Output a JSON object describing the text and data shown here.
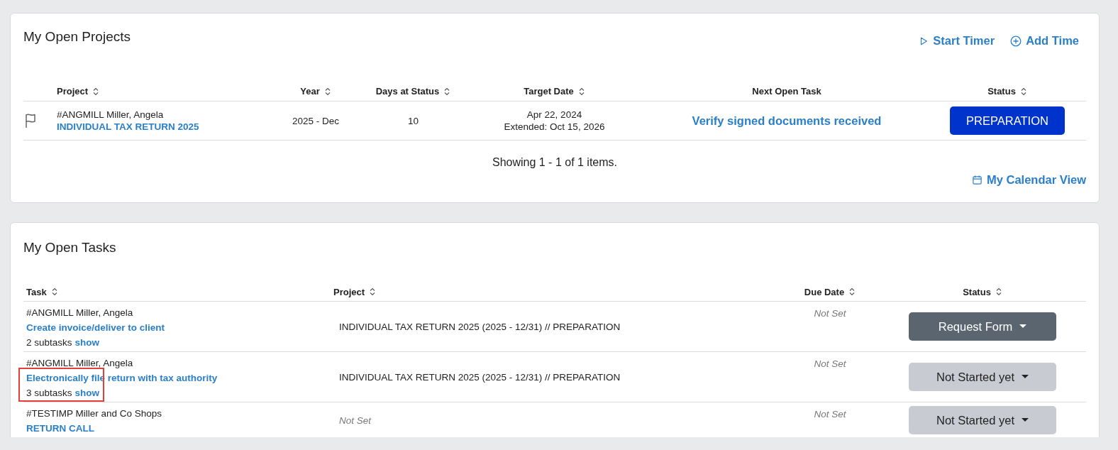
{
  "projects_card": {
    "title": "My Open Projects",
    "actions": [
      {
        "label": "Start Timer",
        "kind": "play"
      },
      {
        "label": "Add Time",
        "kind": "plus"
      }
    ],
    "columns": [
      "Project",
      "Year",
      "Days at Status",
      "Target Date",
      "Next Open Task",
      "Status"
    ],
    "rows": [
      {
        "client": "#ANGMILL Miller, Angela",
        "project": "INDIVIDUAL TAX RETURN 2025",
        "year": "2025 - Dec",
        "days": "10",
        "target": "Apr 22, 2024",
        "extended": "Extended: Oct 15, 2026",
        "next_task": "Verify signed documents received",
        "status": "PREPARATION"
      }
    ],
    "summary": "Showing 1 - 1 of 1 items.",
    "calendar_link": "My Calendar View"
  },
  "tasks_card": {
    "title": "My Open Tasks",
    "columns": [
      "Task",
      "Project",
      "Due Date",
      "Status"
    ],
    "rows": [
      {
        "client": "#ANGMILL Miller, Angela",
        "task": "Create invoice/deliver to client",
        "subtasks": "2 subtasks",
        "show": "show",
        "highlighted": false,
        "project": "INDIVIDUAL TAX RETURN 2025 (2025 - 12/31) // PREPARATION",
        "project_missing": false,
        "due": "Not Set",
        "due_missing": true,
        "status": "Request Form",
        "kind": "filled"
      },
      {
        "client": "#ANGMILL Miller, Angela",
        "task": "Electronically file return with tax authority",
        "subtasks": "3 subtasks",
        "show": "show",
        "highlighted": true,
        "project": "INDIVIDUAL TAX RETURN 2025 (2025 - 12/31) // PREPARATION",
        "project_missing": false,
        "due": "Not Set",
        "due_missing": true,
        "status": "Not Started yet",
        "kind": "muted"
      },
      {
        "client": "#TESTIMP Miller and Co Shops",
        "task": "RETURN CALL",
        "highlighted": false,
        "project": "Not Set",
        "project_missing": true,
        "due": "Not Set",
        "due_missing": true,
        "status": "Not Started yet",
        "kind": "muted"
      }
    ]
  }
}
